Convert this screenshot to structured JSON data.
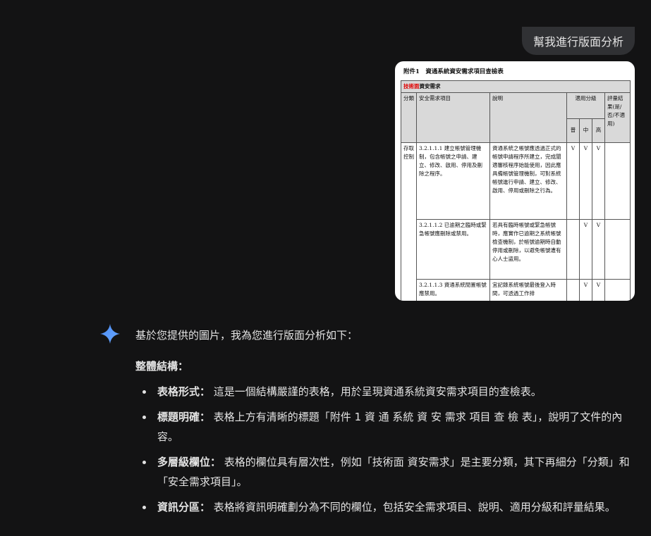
{
  "user_message": "幫我進行版面分析",
  "attachment": {
    "doc_title": "附件1　資通系統資安需求項目查檢表",
    "section_red": "技術面",
    "section_rest": "資安需求",
    "headers": {
      "category": "分類",
      "item": "安全需求項目",
      "desc": "說明",
      "levels": "適用分級",
      "result": "評量結果(是/否/不適用)",
      "level_low": "普",
      "level_mid": "中",
      "level_high": "高"
    },
    "rows": [
      {
        "category": "存取控制",
        "item": "3.2.1.1.1 建立帳號管理機制，包含帳號之申請、建立、修改、啟用、停用及刪除之程序。",
        "desc": "資通系統之帳號應透過正式的帳號申請程序所建立，完成闡適審核程序始能使用，因此應具備帳號管理機制，可對系統帳號進行申請、建立、修改、啟用、停用或刪除之行為。",
        "low": "V",
        "mid": "V",
        "high": "V"
      },
      {
        "item": "3.2.1.1.2 已逾期之臨時或緊急帳號應刪除或禁用。",
        "desc": "若具有臨時帳號或緊急帳號時，應實作已逾期之系統帳號檢查機制，於帳號逾期時自動停用或刪除，以避免帳號遭有心人士盜用。",
        "low": "",
        "mid": "V",
        "high": "V"
      },
      {
        "item": "3.2.1.1.3 資通系統閒置帳號應禁用。",
        "desc": "宜記錄系統帳號最後登入時間，可透過工作排",
        "low": "",
        "mid": "V",
        "high": "V"
      }
    ]
  },
  "response": {
    "intro": "基於您提供的圖片，我為您進行版面分析如下：",
    "section_title": "整體結構：",
    "bullets": [
      {
        "term": "表格形式：",
        "text": "這是一個結構嚴謹的表格，用於呈現資通系統資安需求項目的查檢表。"
      },
      {
        "term": "標題明確：",
        "text": "表格上方有清晰的標題「附件 1 資 通 系統 資 安 需求 項目 查 檢 表」，說明了文件的內容。"
      },
      {
        "term": "多層級欄位：",
        "text": "表格的欄位具有層次性，例如「技術面 資安需求」是主要分類，其下再細分「分類」和「安全需求項目」。"
      },
      {
        "term": "資訊分區：",
        "text": "表格將資訊明確劃分為不同的欄位，包括安全需求項目、說明、適用分級和評量結果。"
      }
    ]
  },
  "colors": {
    "background": "#131314",
    "bubble": "#303134",
    "text": "#e3e3e3",
    "accent_red": "#e00000",
    "spark_blue": "#4c8df6"
  },
  "icons": {
    "assistant": "gemini-spark-icon"
  }
}
